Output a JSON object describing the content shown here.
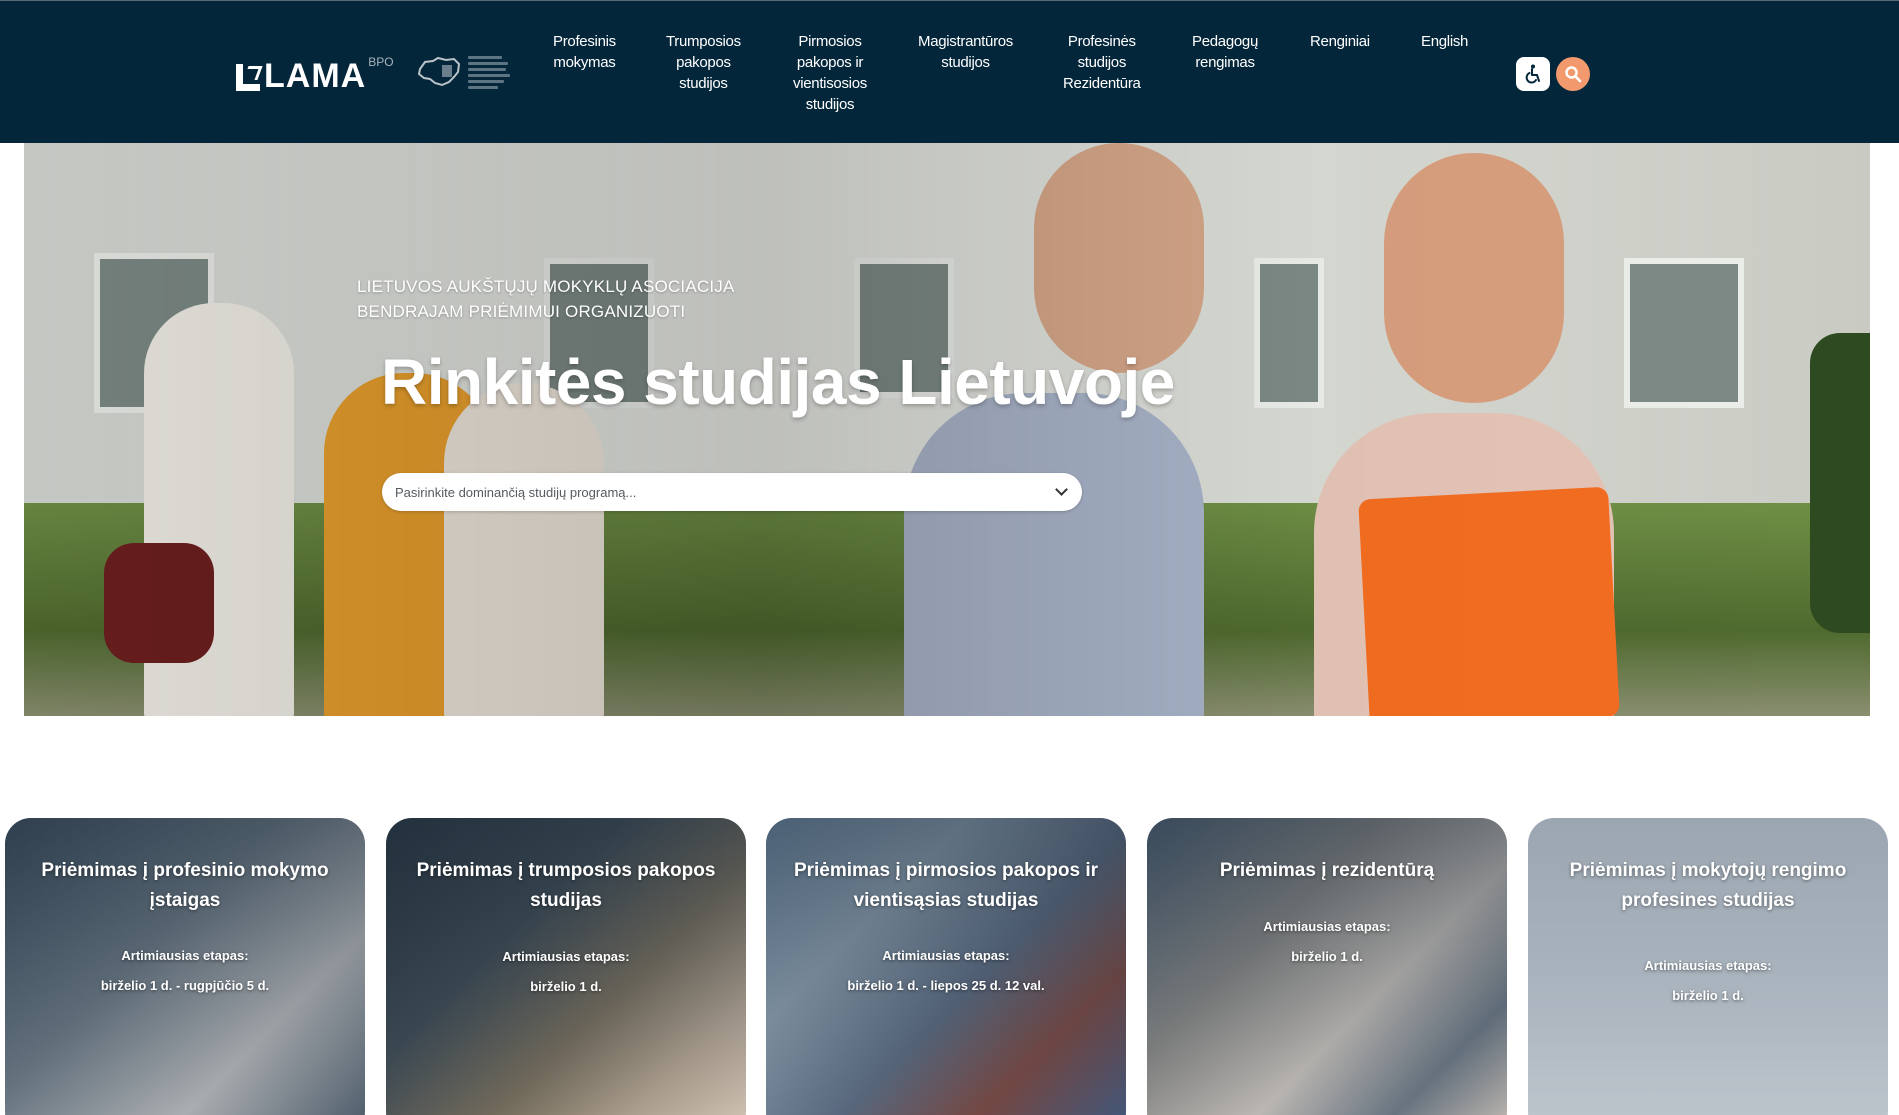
{
  "header": {
    "logo_text": "LAMA",
    "logo_sup": "BPO",
    "nav": [
      {
        "id": "profesinis",
        "lines": [
          "Profesinis",
          "mokymas"
        ]
      },
      {
        "id": "trumposios",
        "lines": [
          "Trumposios",
          "pakopos",
          "studijos"
        ]
      },
      {
        "id": "pirmosios",
        "lines": [
          "Pirmosios",
          "pakopos ir",
          "vientisosios",
          "studijos"
        ]
      },
      {
        "id": "magistranturos",
        "lines": [
          "Magistrantūros",
          "studijos"
        ]
      },
      {
        "id": "profesines",
        "lines": [
          "Profesinės",
          "studijos",
          "Rezidentūra"
        ]
      },
      {
        "id": "pedagogu",
        "lines": [
          "Pedagogų",
          "rengimas"
        ]
      },
      {
        "id": "renginiai",
        "lines": [
          "Renginiai"
        ]
      },
      {
        "id": "english",
        "lines": [
          "English"
        ]
      }
    ],
    "accessibility_icon": "wheelchair-icon",
    "search_icon": "search-icon"
  },
  "hero": {
    "kicker_line1": "LIETUVOS AUKŠTŲJŲ MOKYKLŲ ASOCIACIJA",
    "kicker_line2": "BENDRAJAM PRIĖMIMUI ORGANIZUOTI",
    "title": "Rinkitės studijas Lietuvoje",
    "select_placeholder": "Pasirinkite dominančią studijų programą..."
  },
  "cards": [
    {
      "title": "Priėmimas į profesinio mokymo įstaigas",
      "stage_label": "Artimiausias etapas:",
      "stage_date": "birželio 1 d. - rugpjūčio 5 d."
    },
    {
      "title": "Priėmimas į trumposios pakopos studijas",
      "stage_label": "Artimiausias etapas:",
      "stage_date": "birželio 1 d."
    },
    {
      "title": "Priėmimas į pirmosios pakopos ir vientisąsias studijas",
      "stage_label": "Artimiausias etapas:",
      "stage_date": "birželio 1 d. - liepos 25 d. 12 val."
    },
    {
      "title": "Priėmimas į rezidentūrą",
      "stage_label": "Artimiausias etapas:",
      "stage_date": "birželio 1 d."
    },
    {
      "title": "Priėmimas į mokytojų rengimo profesines studijas",
      "stage_label": "Artimiausias etapas:",
      "stage_date": "birželio 1 d."
    }
  ],
  "colors": {
    "header_bg": "#04263a",
    "search_accent": "#f29a6d"
  }
}
